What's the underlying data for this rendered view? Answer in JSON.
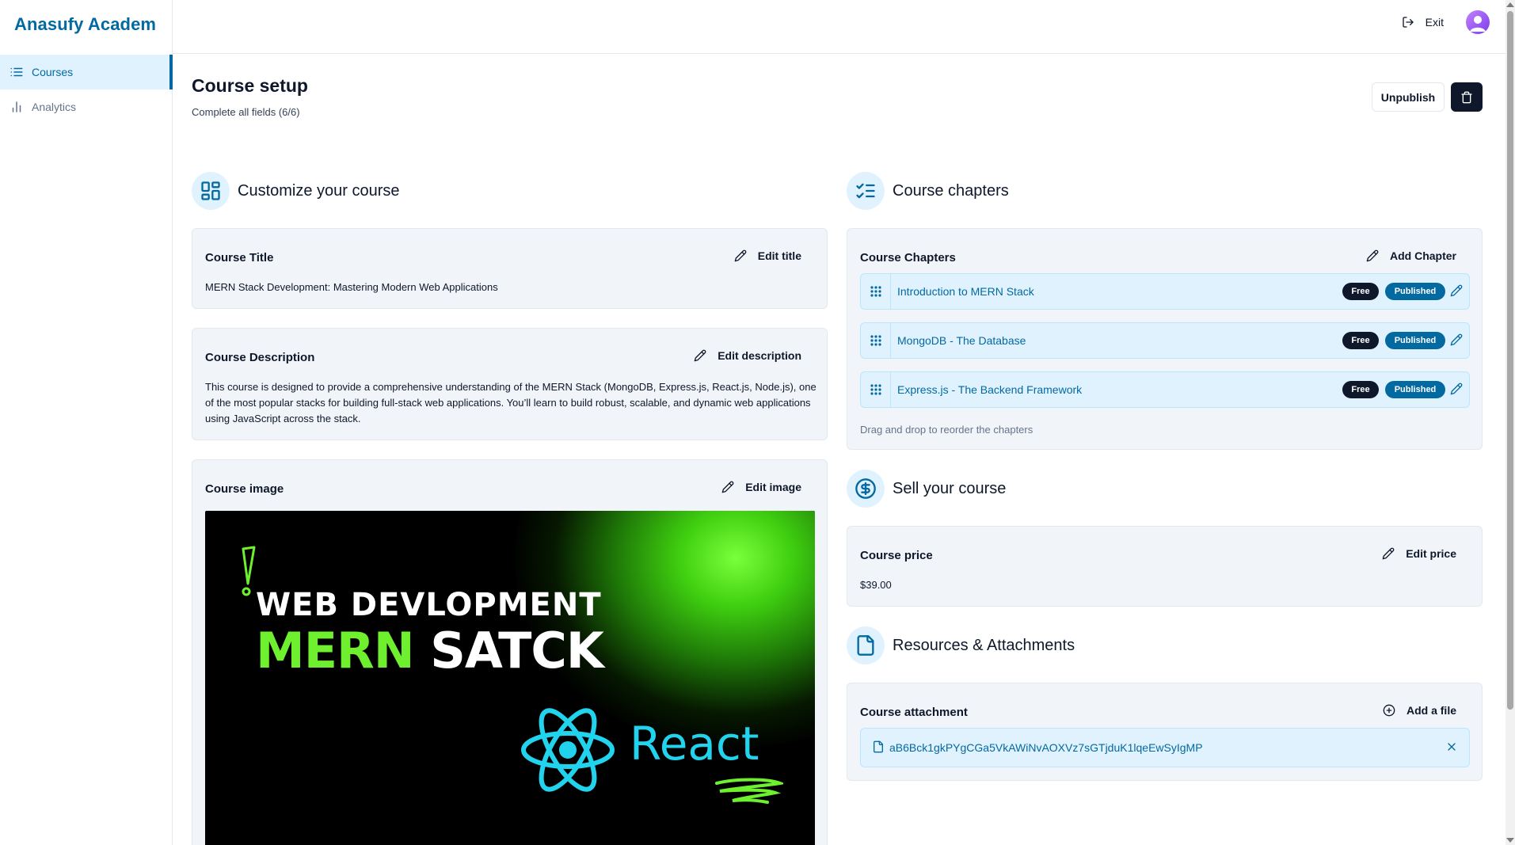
{
  "app": {
    "logo": "Anasufy Academ"
  },
  "sidebar": {
    "items": [
      {
        "label": "Courses",
        "icon": "list-icon",
        "active": true
      },
      {
        "label": "Analytics",
        "icon": "bar-chart-icon",
        "active": false
      }
    ]
  },
  "topbar": {
    "exit_label": "Exit"
  },
  "header": {
    "title": "Course setup",
    "subtitle": "Complete all fields (6/6)",
    "unpublish_label": "Unpublish"
  },
  "left": {
    "section_title": "Customize your course",
    "title_card": {
      "label": "Course Title",
      "action": "Edit title",
      "value": "MERN Stack Development: Mastering Modern Web Applications"
    },
    "description_card": {
      "label": "Course Description",
      "action": "Edit description",
      "value": "This course is designed to provide a comprehensive understanding of the MERN Stack (MongoDB, Express.js, React.js, Node.js), one of the most popular stacks for building full-stack web applications. You’ll learn to build robust, scalable, and dynamic web applications using JavaScript across the stack."
    },
    "image_card": {
      "label": "Course image",
      "action": "Edit image",
      "image_text": {
        "line1": "WEB DEVLOPMENT",
        "line2a": "MERN",
        "line2b": "SATCK",
        "react": "React"
      }
    }
  },
  "right": {
    "chapters_section_title": "Course chapters",
    "chapters_card": {
      "label": "Course Chapters",
      "action": "Add Chapter",
      "chapters": [
        {
          "title": "Introduction to MERN Stack",
          "free": "Free",
          "status": "Published"
        },
        {
          "title": "MongoDB - The Database",
          "free": "Free",
          "status": "Published"
        },
        {
          "title": "Express.js - The Backend Framework",
          "free": "Free",
          "status": "Published"
        }
      ],
      "hint": "Drag and drop to reorder the chapters"
    },
    "sell_section_title": "Sell your course",
    "price_card": {
      "label": "Course price",
      "action": "Edit price",
      "value": "$39.00"
    },
    "resources_section_title": "Resources & Attachments",
    "attachment_card": {
      "label": "Course attachment",
      "action": "Add a file",
      "file_name": "aB6Bck1gkPYgCGa5VkAWiNvAOXVz7sGTjduK1lqeEwSyIgMP"
    }
  },
  "colors": {
    "accent": "#0369a1",
    "accent_bg": "#e0f2fe",
    "dark": "#0f172a",
    "card_bg": "#f1f5f9"
  }
}
